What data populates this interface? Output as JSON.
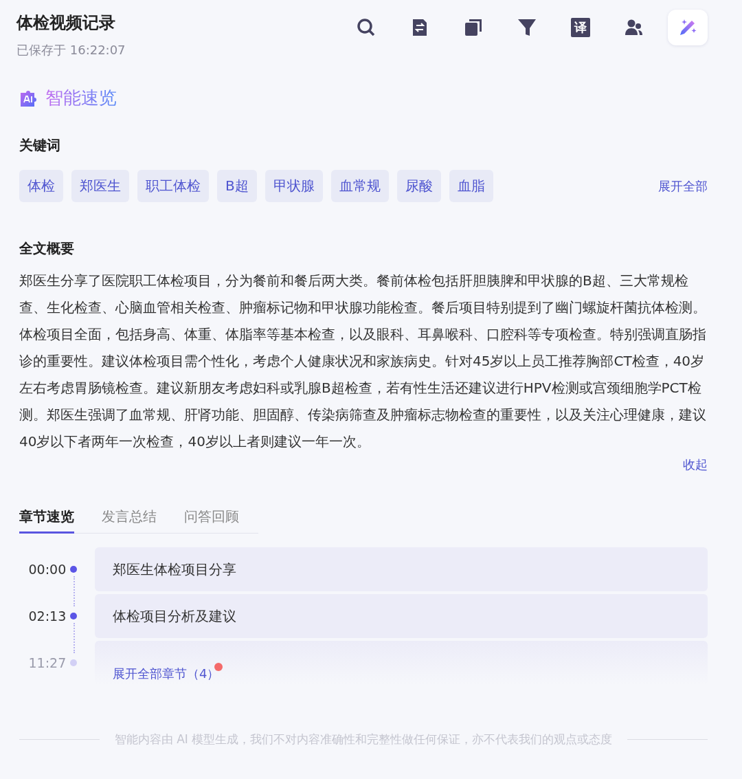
{
  "header": {
    "title": "体检视频记录",
    "saved": "已保存于 16:22:07"
  },
  "toolbar": [
    {
      "kind": "search",
      "selected": false
    },
    {
      "kind": "doc-swap",
      "selected": false
    },
    {
      "kind": "copy",
      "selected": false
    },
    {
      "kind": "filter",
      "selected": false
    },
    {
      "kind": "translate",
      "label": "译",
      "selected": false
    },
    {
      "kind": "people",
      "selected": false
    },
    {
      "kind": "magic",
      "selected": true
    }
  ],
  "ai_heading": "智能速览",
  "keywords": {
    "label": "关键词",
    "tags": [
      "体检",
      "郑医生",
      "职工体检",
      "B超",
      "甲状腺",
      "血常规",
      "尿酸",
      "血脂"
    ],
    "expand": "展开全部"
  },
  "summary": {
    "label": "全文概要",
    "text": "郑医生分享了医院职工体检项目，分为餐前和餐后两大类。餐前体检包括肝胆胰脾和甲状腺的B超、三大常规检查、生化检查、心脑血管相关检查、肿瘤标记物和甲状腺功能检查。餐后项目特别提到了幽门螺旋杆菌抗体检测。体检项目全面，包括身高、体重、体脂率等基本检查，以及眼科、耳鼻喉科、口腔科等专项检查。特别强调直肠指诊的重要性。建议体检项目需个性化，考虑个人健康状况和家族病史。针对45岁以上员工推荐胸部CT检查，40岁左右考虑胃肠镜检查。建议新朋友考虑妇科或乳腺B超检查，若有性生活还建议进行HPV检测或宫颈细胞学PCT检测。郑医生强调了血常规、肝肾功能、胆固醇、传染病筛查及肿瘤标志物检查的重要性，以及关注心理健康，建议40岁以下者两年一次检查，40岁以上者则建议一年一次。",
    "collapse": "收起"
  },
  "tabs": [
    {
      "label": "章节速览",
      "selected": true
    },
    {
      "label": "发言总结",
      "selected": false
    },
    {
      "label": "问答回顾",
      "selected": false
    }
  ],
  "chapters": [
    {
      "time": "00:00",
      "title": "郑医生体检项目分享",
      "faded": false
    },
    {
      "time": "02:13",
      "title": "体检项目分析及建议",
      "faded": false
    },
    {
      "time": "11:27",
      "faded": true
    }
  ],
  "expand_chapters": {
    "label": "展开全部章节（4）",
    "unread": true
  },
  "disclaimer": "智能内容由 AI 模型生成，我们不对内容准确性和完整性做任何保证，亦不代表我们的观点或态度"
}
